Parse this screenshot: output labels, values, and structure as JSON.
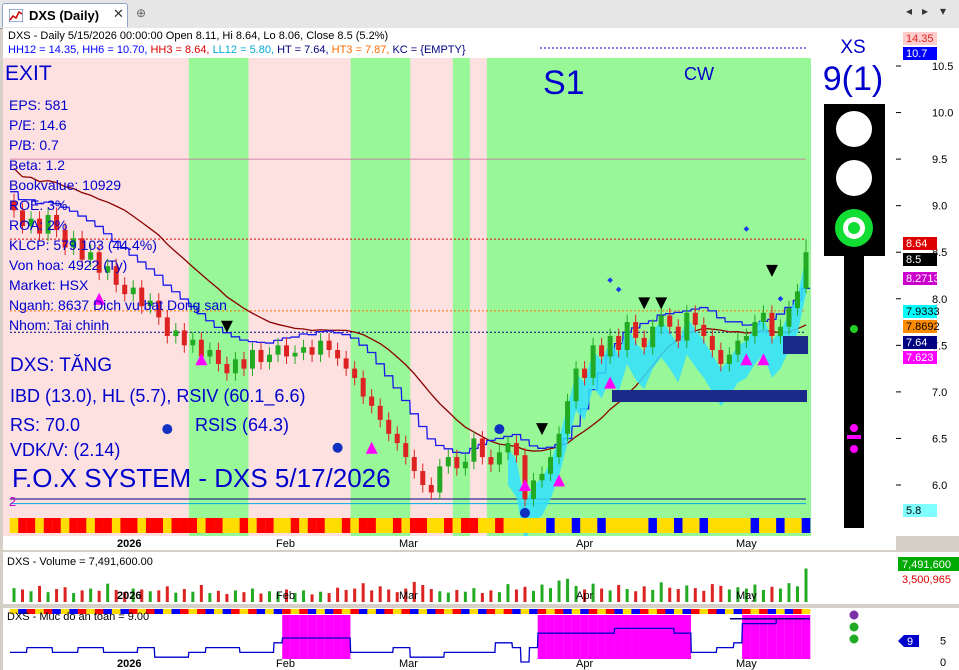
{
  "tab": {
    "title": "DXS (Daily)",
    "close": "✕",
    "pin": "⊕"
  },
  "window_controls": [
    "◂",
    "▸",
    "▾"
  ],
  "header": {
    "line1": "DXS - Daily 5/15/2026 00:00:00 Open 8.11, Hi 8.64, Lo 8.06, Close 8.5 (5.2%)",
    "line2": [
      {
        "text": "HH12 = 14.35, HH6 = 10.70, ",
        "color": "#0000ff"
      },
      {
        "text": "HH3 = 8.64, ",
        "color": "#dd0000"
      },
      {
        "text": "LL12 = 5.80, ",
        "color": "#00aadd"
      },
      {
        "text": "HT = 7.64, ",
        "color": "#000080"
      },
      {
        "text": "HT3 = 7.87, ",
        "color": "#ff6a00"
      },
      {
        "text": "KC = {EMPTY}",
        "color": "#000080"
      }
    ]
  },
  "info_panel": {
    "status": "EXIT",
    "items": [
      "EPS: 581",
      "P/E: 14.6",
      "P/B: 0.7",
      "Beta: 1.2",
      "Bookvalue: 10929",
      "ROE: 3%",
      "ROA: 2%",
      "KLCP: 579.103 (44.4%)",
      "Von hoa: 4922 (Ty)",
      "Market: HSX",
      "Nganh: 8637 Dich vu bat Dong san",
      "Nhom: Tai chinh"
    ],
    "trend": "DXS: TĂNG",
    "ibd": "IBD (13.0), HL (5.7), RSIV (60.1_6.6)",
    "rs": "RS: 70.0",
    "rsis": "RSIS (64.3)",
    "vdk": "VDK/V:  (2.14)",
    "footer": "F.O.X SYSTEM - DXS 5/17/2026",
    "lower_left": "2"
  },
  "signals": {
    "s1": "S1",
    "cw": "CW",
    "xs": "XS",
    "xs_count": "9(1)"
  },
  "colors": {
    "up": "#22aa22",
    "down": "#dd2222",
    "bull_bg": "#98f898",
    "bear_bg": "#fde0e0",
    "ma_slow": "#8b0000",
    "ma_fast": "#1a1aee"
  },
  "chart_data": [
    {
      "type": "candlestick",
      "symbol": "DXS",
      "period": "Daily",
      "last_bar": {
        "date": "5/15/2026",
        "open": 8.11,
        "high": 8.64,
        "low": 8.06,
        "close": 8.5,
        "change_pct": 5.2
      },
      "x_labels": [
        "2026",
        "Feb",
        "Mar",
        "Apr",
        "May"
      ],
      "y_ticks": [
        6.0,
        6.5,
        7.0,
        7.5,
        8.0,
        8.5,
        9.0,
        9.5,
        10.0,
        10.5
      ],
      "ylim": [
        5.5,
        10.8
      ],
      "closes": [
        8.95,
        8.78,
        8.86,
        8.7,
        8.9,
        8.74,
        8.55,
        8.65,
        8.42,
        8.5,
        8.28,
        8.35,
        8.15,
        8.05,
        8.12,
        7.92,
        7.98,
        7.8,
        7.6,
        7.66,
        7.5,
        7.56,
        7.38,
        7.45,
        7.3,
        7.2,
        7.35,
        7.25,
        7.45,
        7.32,
        7.4,
        7.5,
        7.38,
        7.42,
        7.48,
        7.4,
        7.55,
        7.45,
        7.36,
        7.25,
        7.15,
        6.95,
        6.85,
        6.7,
        6.55,
        6.45,
        6.3,
        6.15,
        6.0,
        5.92,
        6.2,
        6.3,
        6.18,
        6.25,
        6.5,
        6.3,
        6.22,
        6.35,
        6.45,
        6.32,
        5.85,
        6.05,
        6.12,
        6.3,
        6.55,
        6.9,
        7.25,
        7.15,
        7.5,
        7.38,
        7.6,
        7.45,
        7.75,
        7.58,
        7.48,
        7.7,
        7.82,
        7.7,
        7.55,
        7.85,
        7.72,
        7.6,
        7.45,
        7.3,
        7.4,
        7.55,
        7.6,
        7.75,
        7.85,
        7.6,
        7.7,
        7.9,
        8.08,
        8.5
      ],
      "price_labels": [
        {
          "text": "14.35",
          "color": "#dd2222",
          "bg": "#ffcccc"
        },
        {
          "text": "10.7",
          "color": "#ffffff",
          "bg": "#0000ff"
        },
        {
          "text": "8.64",
          "color": "#ffffff",
          "bg": "#dd0000"
        },
        {
          "text": "8.5",
          "color": "#ffffff",
          "bg": "#000000"
        },
        {
          "text": "8.27139",
          "color": "#ffffff",
          "bg": "#cc00cc"
        },
        {
          "text": "7.9333",
          "color": "#000000",
          "bg": "#00ffff"
        },
        {
          "text": "7.8692",
          "color": "#000000",
          "bg": "#ff8c00"
        },
        {
          "text": "7.64",
          "color": "#ffffff",
          "bg": "#000080"
        },
        {
          "text": "7.623",
          "color": "#ffffff",
          "bg": "#ff00ff"
        },
        {
          "text": "5.8",
          "color": "#000000",
          "bg": "#80ffff"
        }
      ]
    },
    {
      "type": "bar",
      "title": "DXS - Volume = 7,491,600.00",
      "last_value": 7491600,
      "labels": [
        "7,491,600",
        "3,500,965"
      ],
      "values": [
        3.1,
        2.8,
        2.4,
        3.6,
        2.2,
        2.9,
        3.3,
        2.0,
        2.6,
        3.0,
        2.5,
        4.1,
        2.7,
        2.2,
        3.0,
        2.8,
        2.4,
        2.6,
        3.5,
        2.1,
        2.9,
        2.3,
        3.8,
        2.0,
        2.5,
        1.8,
        2.6,
        2.2,
        3.0,
        1.9,
        2.4,
        2.1,
        2.8,
        2.0,
        2.6,
        1.7,
        2.3,
        2.0,
        3.2,
        2.7,
        3.0,
        4.2,
        2.6,
        3.5,
        2.8,
        2.2,
        3.0,
        4.5,
        3.8,
        2.9,
        2.4,
        2.1,
        2.7,
        2.3,
        3.1,
        2.0,
        2.6,
        2.2,
        4.0,
        2.8,
        3.4,
        2.5,
        3.9,
        3.1,
        4.8,
        5.2,
        3.6,
        2.8,
        4.1,
        3.0,
        2.6,
        3.8,
        2.9,
        2.4,
        3.5,
        2.7,
        4.4,
        3.2,
        2.9,
        3.7,
        3.1,
        2.5,
        4.0,
        3.6,
        2.8,
        3.3,
        3.0,
        3.9,
        2.7,
        3.4,
        3.0,
        4.2,
        3.5,
        7.49
      ]
    },
    {
      "type": "line",
      "title": "DXS - Muc do an toan = 9.00",
      "last_value": 9,
      "y_ticks": [
        0,
        5
      ],
      "values": [
        2,
        2,
        3,
        3,
        3,
        2,
        2,
        2,
        3,
        3,
        3,
        2,
        2,
        2,
        2,
        3,
        3,
        1,
        1,
        1,
        1,
        2,
        2,
        3,
        3,
        3,
        3,
        2,
        2,
        2,
        2,
        4,
        5,
        5,
        5,
        5,
        5,
        5,
        5,
        5,
        2,
        2,
        2,
        2,
        2,
        3,
        3,
        1,
        1,
        1,
        1,
        2,
        2,
        2,
        2,
        2,
        2,
        4,
        4,
        3,
        0,
        3,
        6,
        6,
        6,
        6,
        6,
        6,
        6,
        6,
        6,
        7,
        7,
        7,
        7,
        7,
        7,
        7,
        6,
        6,
        2,
        2,
        2,
        3,
        3,
        4,
        8,
        8,
        8,
        8,
        9,
        9,
        9,
        9
      ]
    }
  ]
}
